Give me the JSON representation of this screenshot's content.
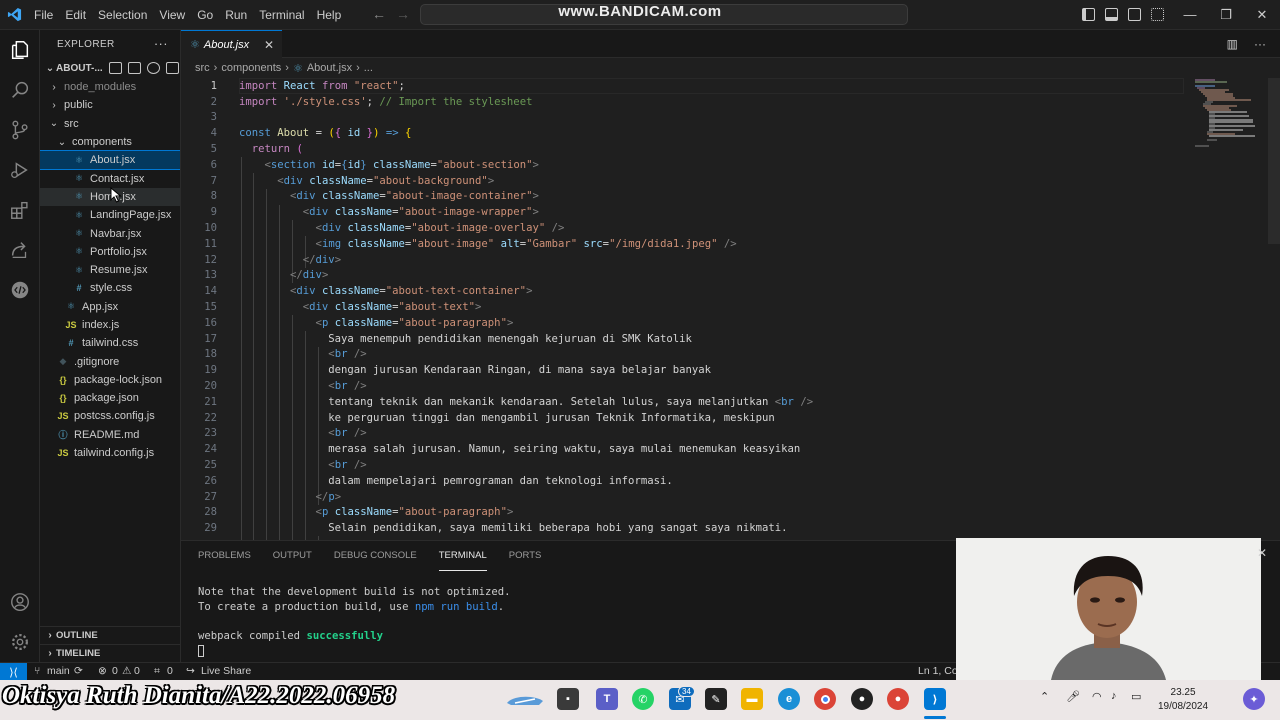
{
  "window": {
    "menu": [
      "File",
      "Edit",
      "Selection",
      "View",
      "Go",
      "Run",
      "Terminal",
      "Help"
    ],
    "watermark": "www.BANDICAM.com"
  },
  "explorer": {
    "title": "EXPLORER",
    "more": "···",
    "project": "ABOUT-...",
    "tree": [
      {
        "label": "node_modules",
        "kind": "folder",
        "depth": 1,
        "open": false,
        "muted": true
      },
      {
        "label": "public",
        "kind": "folder",
        "depth": 1,
        "open": false
      },
      {
        "label": "src",
        "kind": "folder",
        "depth": 1,
        "open": true
      },
      {
        "label": "components",
        "kind": "folder",
        "depth": 2,
        "open": true
      },
      {
        "label": "About.jsx",
        "kind": "react",
        "depth": 3,
        "selected": true
      },
      {
        "label": "Contact.jsx",
        "kind": "react",
        "depth": 3
      },
      {
        "label": "Home.jsx",
        "kind": "react",
        "depth": 3,
        "hover": true
      },
      {
        "label": "LandingPage.jsx",
        "kind": "react",
        "depth": 3
      },
      {
        "label": "Navbar.jsx",
        "kind": "react",
        "depth": 3
      },
      {
        "label": "Portfolio.jsx",
        "kind": "react",
        "depth": 3
      },
      {
        "label": "Resume.jsx",
        "kind": "react",
        "depth": 3
      },
      {
        "label": "style.css",
        "kind": "css",
        "depth": 3
      },
      {
        "label": "App.jsx",
        "kind": "react",
        "depth": 2
      },
      {
        "label": "index.js",
        "kind": "js",
        "depth": 2
      },
      {
        "label": "tailwind.css",
        "kind": "css",
        "depth": 2
      },
      {
        "label": ".gitignore",
        "kind": "git",
        "depth": 1
      },
      {
        "label": "package-lock.json",
        "kind": "json",
        "depth": 1
      },
      {
        "label": "package.json",
        "kind": "json",
        "depth": 1
      },
      {
        "label": "postcss.config.js",
        "kind": "js",
        "depth": 1
      },
      {
        "label": "README.md",
        "kind": "info",
        "depth": 1
      },
      {
        "label": "tailwind.config.js",
        "kind": "js",
        "depth": 1
      }
    ],
    "outline": "OUTLINE",
    "timeline": "TIMELINE"
  },
  "editor": {
    "tab_label": "About.jsx",
    "breadcrumb": [
      "src",
      "components",
      "About.jsx",
      "..."
    ],
    "lines": [
      {
        "n": "1",
        "html": "<span class='k'>import</span> <span class='v'>React</span> <span class='k'>from</span> <span class='s'>\"react\"</span><span class='w'>;</span>"
      },
      {
        "n": "2",
        "html": "<span class='k'>import</span> <span class='s'>'./style.css'</span><span class='w'>;</span> <span class='c'>// Import the stylesheet</span>"
      },
      {
        "n": "3",
        "html": ""
      },
      {
        "n": "4",
        "html": "<span class='b'>const</span> <span class='f'>About</span> <span class='w'>=</span> <span class='y'>(</span><span class='p'>{</span> <span class='v'>id</span> <span class='p'>}</span><span class='y'>)</span> <span class='b'>=></span> <span class='y'>{</span>"
      },
      {
        "n": "5",
        "html": "  <span class='k'>return</span> <span class='p'>(</span>"
      },
      {
        "n": "6",
        "html": "    <span class='tg'>&lt;</span><span class='b'>section</span> <span class='v'>id</span><span class='w'>=</span><span class='b'>{</span><span class='v'>id</span><span class='b'>}</span> <span class='v'>className</span><span class='w'>=</span><span class='s'>\"about-section\"</span><span class='tg'>&gt;</span>"
      },
      {
        "n": "7",
        "html": "      <span class='tg'>&lt;</span><span class='b'>div</span> <span class='v'>className</span><span class='w'>=</span><span class='s'>\"about-background\"</span><span class='tg'>&gt;</span>"
      },
      {
        "n": "8",
        "html": "        <span class='tg'>&lt;</span><span class='b'>div</span> <span class='v'>className</span><span class='w'>=</span><span class='s'>\"about-image-container\"</span><span class='tg'>&gt;</span>"
      },
      {
        "n": "9",
        "html": "          <span class='tg'>&lt;</span><span class='b'>div</span> <span class='v'>className</span><span class='w'>=</span><span class='s'>\"about-image-wrapper\"</span><span class='tg'>&gt;</span>"
      },
      {
        "n": "10",
        "html": "            <span class='tg'>&lt;</span><span class='b'>div</span> <span class='v'>className</span><span class='w'>=</span><span class='s'>\"about-image-overlay\"</span> <span class='tg'>/&gt;</span>"
      },
      {
        "n": "11",
        "html": "            <span class='tg'>&lt;</span><span class='b'>img</span> <span class='v'>className</span><span class='w'>=</span><span class='s'>\"about-image\"</span> <span class='v'>alt</span><span class='w'>=</span><span class='s'>\"Gambar\"</span> <span class='v'>src</span><span class='w'>=</span><span class='s'>\"/img/dida1.jpeg\"</span> <span class='tg'>/&gt;</span>"
      },
      {
        "n": "12",
        "html": "          <span class='tg'>&lt;/</span><span class='b'>div</span><span class='tg'>&gt;</span>"
      },
      {
        "n": "13",
        "html": "        <span class='tg'>&lt;/</span><span class='b'>div</span><span class='tg'>&gt;</span>"
      },
      {
        "n": "14",
        "html": "        <span class='tg'>&lt;</span><span class='b'>div</span> <span class='v'>className</span><span class='w'>=</span><span class='s'>\"about-text-container\"</span><span class='tg'>&gt;</span>"
      },
      {
        "n": "15",
        "html": "          <span class='tg'>&lt;</span><span class='b'>div</span> <span class='v'>className</span><span class='w'>=</span><span class='s'>\"about-text\"</span><span class='tg'>&gt;</span>"
      },
      {
        "n": "16",
        "html": "            <span class='tg'>&lt;</span><span class='b'>p</span> <span class='v'>className</span><span class='w'>=</span><span class='s'>\"about-paragraph\"</span><span class='tg'>&gt;</span>"
      },
      {
        "n": "17",
        "html": "              <span class='w'>Saya menempuh pendidikan menengah kejuruan di SMK Katolik</span>"
      },
      {
        "n": "18",
        "html": "              <span class='tg'>&lt;</span><span class='b'>br</span> <span class='tg'>/&gt;</span>"
      },
      {
        "n": "19",
        "html": "              <span class='w'>dengan jurusan Kendaraan Ringan, di mana saya belajar banyak</span>"
      },
      {
        "n": "20",
        "html": "              <span class='tg'>&lt;</span><span class='b'>br</span> <span class='tg'>/&gt;</span>"
      },
      {
        "n": "21",
        "html": "              <span class='w'>tentang teknik dan mekanik kendaraan. Setelah lulus, saya melanjutkan</span> <span class='tg'>&lt;</span><span class='b'>br</span> <span class='tg'>/&gt;</span>"
      },
      {
        "n": "22",
        "html": "              <span class='w'>ke perguruan tinggi dan mengambil jurusan Teknik Informatika, meskipun</span>"
      },
      {
        "n": "23",
        "html": "              <span class='tg'>&lt;</span><span class='b'>br</span> <span class='tg'>/&gt;</span>"
      },
      {
        "n": "24",
        "html": "              <span class='w'>merasa salah jurusan. Namun, seiring waktu, saya mulai menemukan keasyikan</span>"
      },
      {
        "n": "25",
        "html": "              <span class='tg'>&lt;</span><span class='b'>br</span> <span class='tg'>/&gt;</span>"
      },
      {
        "n": "26",
        "html": "              <span class='w'>dalam mempelajari pemrograman dan teknologi informasi.</span>"
      },
      {
        "n": "27",
        "html": "            <span class='tg'>&lt;/</span><span class='b'>p</span><span class='tg'>&gt;</span>"
      },
      {
        "n": "28",
        "html": "            <span class='tg'>&lt;</span><span class='b'>p</span> <span class='v'>className</span><span class='w'>=</span><span class='s'>\"about-paragraph\"</span><span class='tg'>&gt;</span>"
      },
      {
        "n": "29",
        "html": "              <span class='w'>Selain pendidikan, saya memiliki beberapa hobi yang sangat saya nikmati.</span>"
      }
    ]
  },
  "panel": {
    "tabs": [
      "PROBLEMS",
      "OUTPUT",
      "DEBUG CONSOLE",
      "TERMINAL",
      "PORTS"
    ],
    "active_tab": "TERMINAL",
    "term1": "Note that the development build is not optimized.",
    "term2a": "To create a production build, use ",
    "term2b": "npm run build",
    "term2c": ".",
    "term3a": "webpack compiled ",
    "term3b": "successfully"
  },
  "statusbar": {
    "branch": "main",
    "errors": "0",
    "warnings": "0",
    "ports": "0",
    "live_share": "Live Share",
    "position": "Ln 1, Co"
  },
  "taskbar": {
    "overlay_name": "Oktisya Ruth Dianita/A22.2022.06958",
    "mail_badge": "34",
    "time": "23.25",
    "date": "19/08/2024"
  },
  "colors": {
    "accent": "#0078d4",
    "editor_bg": "#1f1f1f",
    "sidebar_bg": "#181818"
  }
}
